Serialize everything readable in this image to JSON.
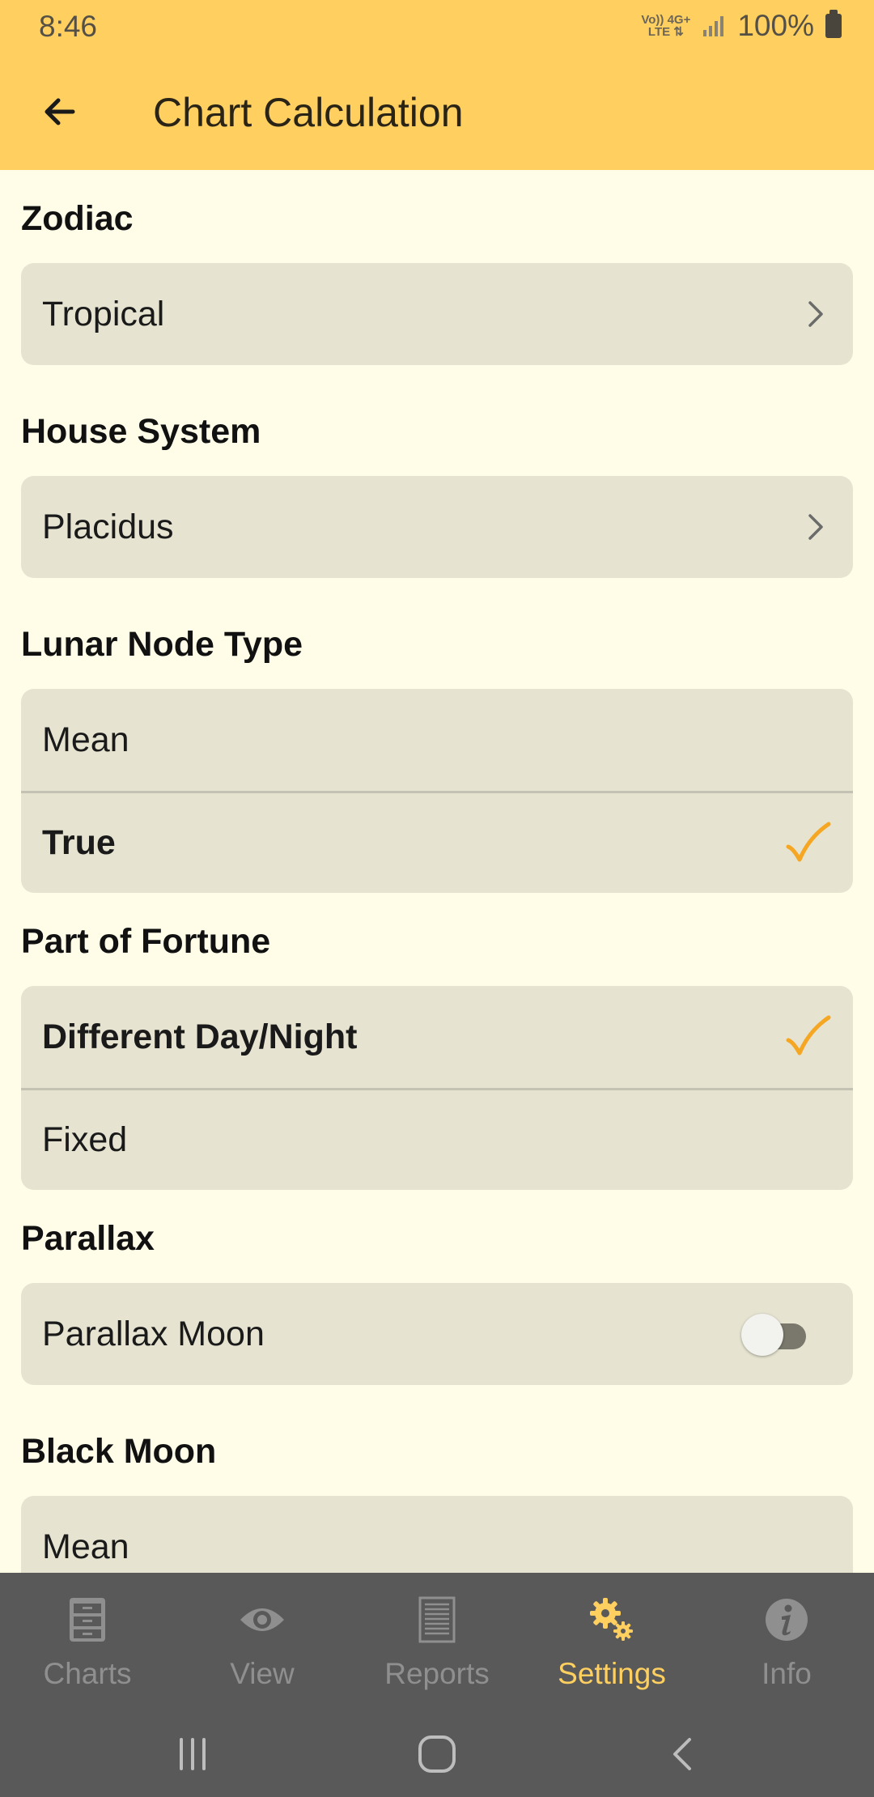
{
  "status_bar": {
    "time": "8:46",
    "network_top": "Vo)) 4G+",
    "network_bottom": "LTE ⇅",
    "battery": "100%"
  },
  "app_bar": {
    "title": "Chart Calculation",
    "back_icon": "arrow-left-icon"
  },
  "colors": {
    "accent": "#ffd060",
    "check": "#f5a623",
    "background": "#fffde8",
    "card": "#e6e4d0",
    "nav_bg": "#595959"
  },
  "sections": {
    "zodiac": {
      "title": "Zodiac",
      "value": "Tropical"
    },
    "house_system": {
      "title": "House System",
      "value": "Placidus"
    },
    "lunar_node": {
      "title": "Lunar Node Type",
      "options": [
        "Mean",
        "True"
      ],
      "selected": "True"
    },
    "part_of_fortune": {
      "title": "Part of Fortune",
      "options": [
        "Different Day/Night",
        "Fixed"
      ],
      "selected": "Different Day/Night"
    },
    "parallax": {
      "title": "Parallax",
      "toggle_label": "Parallax Moon",
      "toggle_on": false
    },
    "black_moon": {
      "title": "Black Moon",
      "options": [
        "Mean"
      ]
    }
  },
  "bottom_nav": {
    "items": [
      {
        "label": "Charts",
        "icon": "file-cabinet-icon",
        "active": false
      },
      {
        "label": "View",
        "icon": "eye-icon",
        "active": false
      },
      {
        "label": "Reports",
        "icon": "document-icon",
        "active": false
      },
      {
        "label": "Settings",
        "icon": "gears-icon",
        "active": true
      },
      {
        "label": "Info",
        "icon": "info-icon",
        "active": false
      }
    ]
  },
  "system_nav": {
    "buttons": [
      "recents-icon",
      "home-icon",
      "back-icon"
    ]
  }
}
